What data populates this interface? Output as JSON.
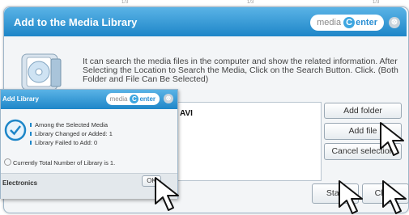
{
  "ruler": {
    "t1": "1/3",
    "t2": "1/3",
    "t3": "1/3"
  },
  "main_dialog": {
    "title": "Add to the Media Library",
    "brand_prefix": "media",
    "brand_letter": "C",
    "brand_suffix": "enter",
    "close_glyph": "⊗",
    "description": "It can search the media files in the computer and show the related information. After Selecting the Location to Search the Media, Click on the Search Button. Click. (Both Folder and File Can Be Selected)",
    "list_items": [
      "AVI"
    ],
    "buttons": {
      "add_folder": "Add folder",
      "add_file": "Add file",
      "cancel_selection": "Cancel selection",
      "start": "Start",
      "close": "Close"
    }
  },
  "popup": {
    "title": "Add Library",
    "brand_prefix": "media",
    "brand_letter": "C",
    "brand_suffix": "enter",
    "close_glyph": "⊗",
    "lines": [
      "Among the Selected Media",
      "Library Changed or Added: 1",
      "Library Failed to Add: 0"
    ],
    "total": "Currently Total Number of Library is 1.",
    "footer_label": "Electronics",
    "ok_label": "OK"
  },
  "colors": {
    "title_bar": "#1e86c8",
    "brand_accent": "#3da6e0"
  }
}
